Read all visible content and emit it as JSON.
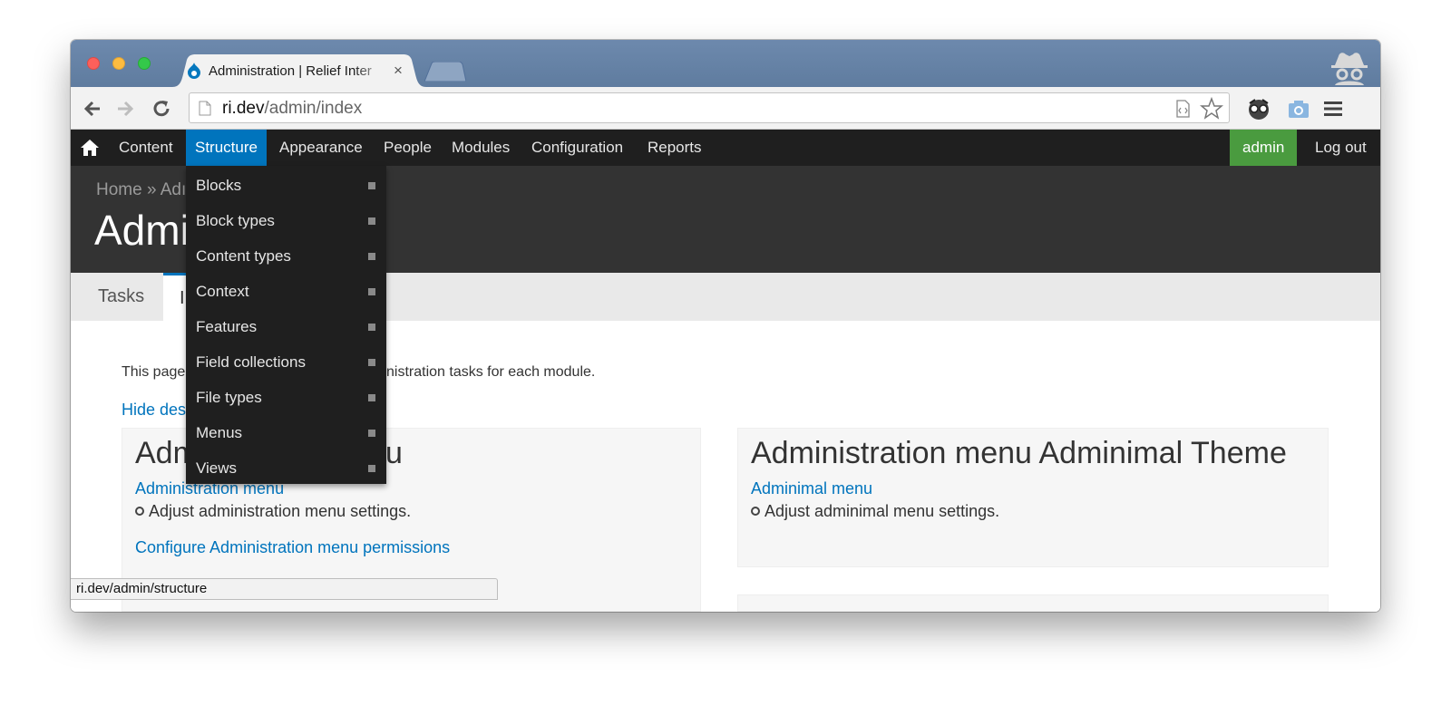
{
  "browser": {
    "tab_title": "Administration | Relief Inter",
    "tab_close": "×",
    "url_host": "ri.dev",
    "url_path": "/admin/index"
  },
  "adminbar": {
    "items": [
      "Content",
      "Structure",
      "Appearance",
      "People",
      "Modules",
      "Configuration",
      "Reports"
    ],
    "active": "Structure",
    "user": "admin",
    "logout": "Log out"
  },
  "header": {
    "breadcrumb": "Home » Adı",
    "title": "Admi"
  },
  "page_tabs": {
    "tasks": "Tasks",
    "index": "I"
  },
  "content": {
    "intro_left": "This page",
    "intro_right": "nistration tasks for each module.",
    "hide_link": "Hide des"
  },
  "panels": [
    {
      "title_left": "Adm",
      "title_right": "u",
      "link": "Administration menu",
      "desc": "Adjust administration menu settings.",
      "extra_link": "Configure Administration menu permissions"
    },
    {
      "title": "Administration menu Adminimal Theme",
      "link": "Adminimal menu",
      "desc": "Adjust adminimal menu settings."
    }
  ],
  "dropdown": {
    "items": [
      "Blocks",
      "Block types",
      "Content types",
      "Context",
      "Features",
      "Field collections",
      "File types",
      "Menus",
      "Views"
    ]
  },
  "status_url": "ri.dev/admin/structure",
  "colors": {
    "admin_bar": "#1f1f1f",
    "active_blue": "#0074bd",
    "admin_green": "#4a9b3f",
    "header_bg": "#333333"
  }
}
